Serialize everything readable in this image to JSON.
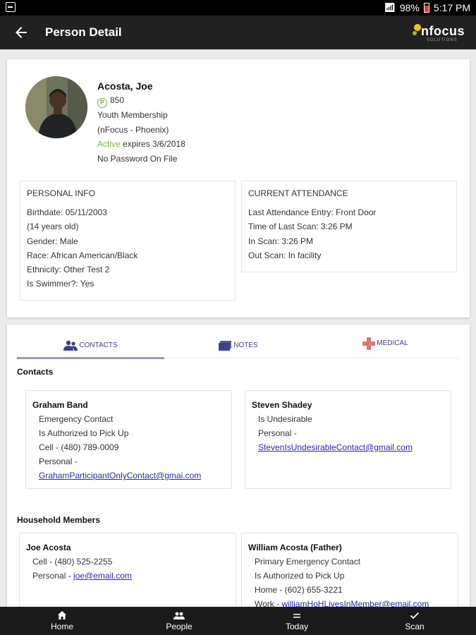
{
  "status_bar": {
    "battery": "98%",
    "time": "5:17 PM"
  },
  "app_bar": {
    "title": "Person Detail",
    "logo_text": "nfocus",
    "logo_sub": "SOLUTIONS"
  },
  "person": {
    "name": "Acosta, Joe",
    "badge_letter": "P",
    "member_id": "850",
    "membership": "Youth Membership",
    "branch": "(nFocus - Phoenix)",
    "status": "Active",
    "expires": "expires 3/6/2018",
    "password": "No Password On File"
  },
  "personal_info": {
    "heading": "PERSONAL INFO",
    "rows": [
      "Birthdate: 05/11/2003",
      "(14 years old)",
      "Gender: Male",
      "Race: African American/Black",
      "Ethnicity: Other Test 2",
      "Is Swimmer?: Yes"
    ]
  },
  "attendance": {
    "heading": "CURRENT ATTENDANCE",
    "rows": [
      "Last Attendance Entry: Front Door",
      "Time of Last Scan: 3:26 PM",
      "In Scan: 3:26 PM",
      "Out Scan: In facility"
    ]
  },
  "tabs": [
    {
      "label": "CONTACTS",
      "icon": "contacts-icon"
    },
    {
      "label": "NOTES",
      "icon": "notes-icon"
    },
    {
      "label": "MEDICAL",
      "icon": "medical-cross-icon"
    }
  ],
  "contacts_section": {
    "title": "Contacts",
    "contacts": [
      {
        "name": "Graham Band",
        "role": "Emergency Contact",
        "auth": "Is Authorized to Pick Up",
        "cell": "Cell - (480) 789-0009",
        "personal_label": "Personal -",
        "email": "GrahamParticipantOnlyContact@gmai.com"
      },
      {
        "name": "Steven Shadey",
        "note": "Is Undesirable",
        "personal_label": "Personal -",
        "email": "StevenIsUndesirableContact@gmail.com"
      }
    ]
  },
  "household_section": {
    "title": "Household Members",
    "members": [
      {
        "name": "Joe Acosta",
        "cell": "Cell - (480) 525-2255",
        "personal_label": "Personal -",
        "email": "joe@email.com"
      },
      {
        "name": "William Acosta (Father)",
        "role": "Primary Emergency Contact",
        "auth": "Is Authorized to Pick Up",
        "home": "Home - (602) 655-3221",
        "work_label": "Work -",
        "email": "williamHoHLivesInMember@email.com"
      }
    ]
  },
  "bottom_nav": [
    {
      "label": "Home",
      "icon": "home-icon"
    },
    {
      "label": "People",
      "icon": "people-icon"
    },
    {
      "label": "Today",
      "icon": "list-icon"
    },
    {
      "label": "Scan",
      "icon": "check-icon"
    }
  ],
  "colors": {
    "accent_green": "#7cb342",
    "tab_text": "#3f3f8f",
    "link": "#2a2aa8",
    "medical_red": "#e57373"
  }
}
